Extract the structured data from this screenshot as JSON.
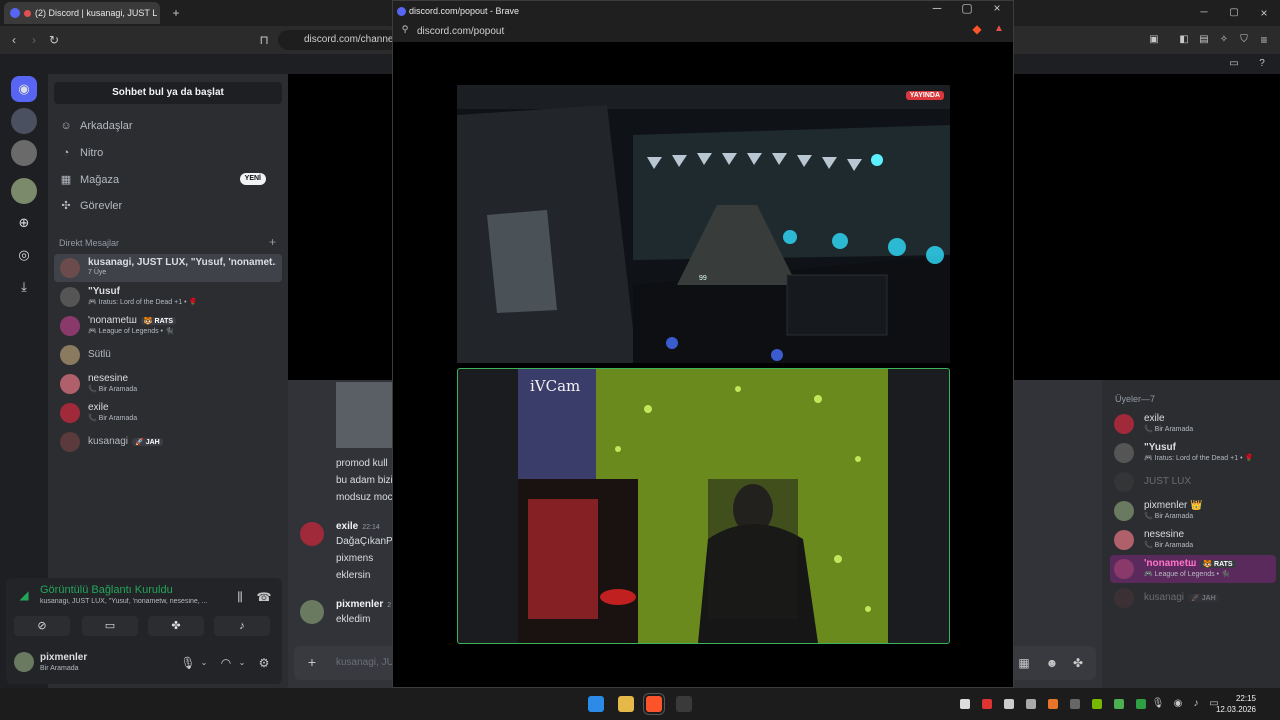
{
  "browser": {
    "tab_title": "(2) Discord | kusanagi, JUST L",
    "address": "discord.com/channel"
  },
  "popup": {
    "title": "discord.com/popout - Brave",
    "url": "discord.com/popout",
    "live_badge": "YAYINDA",
    "cam_label": "iVCam",
    "speed_readout": "99"
  },
  "sidebar": {
    "search": "Sohbet bul ya da başlat",
    "nav": [
      {
        "label": "Arkadaşlar",
        "icon": "friends-icon"
      },
      {
        "label": "Nitro",
        "icon": "nitro-icon"
      },
      {
        "label": "Mağaza",
        "icon": "shop-icon",
        "badge": "YENİ"
      },
      {
        "label": "Görevler",
        "icon": "quests-icon"
      }
    ],
    "dm_header": "Direkt Mesajlar",
    "dms": [
      {
        "name": "kusanagi, JUST LUX, \"Yusuf, 'nonamet...",
        "sub": "7 Üye",
        "color": "#6b4b4b"
      },
      {
        "name": "\"Yusuf",
        "sub": "🎮 Iratus: Lord of the Dead +1 • 🌹",
        "color": "#555"
      },
      {
        "name": "'nonametш",
        "tag": "🐯 RATS",
        "sub": "🎮 League of Legends • 🐈‍⬛",
        "color": "#8a3a6a"
      },
      {
        "name": "Sütlü",
        "sub": "",
        "color": "#8a7a60"
      },
      {
        "name": "nesesine",
        "sub": "📞 Bir Aramada",
        "color": "#b0606a"
      },
      {
        "name": "exile",
        "sub": "📞 Bir Aramada",
        "color": "#a02a3a"
      },
      {
        "name": "kusanagi",
        "tag": "🚀 JAH",
        "sub": "",
        "color": "#5a3a3a"
      }
    ],
    "voice": {
      "title": "Görüntülü Bağlantı Kuruldu",
      "sub": "kusanagi, JUST LUX, \"Yusuf, 'nonametw, nesesine, ..."
    },
    "user": {
      "name": "pixmenler",
      "status": "Bir Aramada"
    }
  },
  "chat": {
    "partial_lines": [
      "promod kull",
      "bu adam bizi",
      "modsuz moc"
    ],
    "messages": [
      {
        "author": "exile",
        "time": "22:14",
        "lines": [
          "DağaÇıkanP",
          "pixmens",
          "eklersin"
        ]
      },
      {
        "author": "pixmenler",
        "time": "2",
        "lines": [
          "ekledim"
        ]
      }
    ],
    "input_placeholder": "kusanagi, JU"
  },
  "members": {
    "header": "Üyeler—7",
    "list": [
      {
        "name": "exile",
        "sub": "📞 Bir Aramada",
        "color": "#a02a3a"
      },
      {
        "name": "\"Yusuf",
        "sub": "🎮 Iratus: Lord of the Dead +1 • 🌹",
        "color": "#555"
      },
      {
        "name": "JUST LUX",
        "sub": "",
        "color": "#444",
        "dim": true
      },
      {
        "name": "pixmenler 👑",
        "sub": "📞 Bir Aramada",
        "color": "#6a7a60"
      },
      {
        "name": "nesesine",
        "sub": "📞 Bir Aramada",
        "color": "#b0606a"
      },
      {
        "name": "'nonametш",
        "tag": "🐯 RATS",
        "sub": "🎮 League of Legends • 🐈‍⬛",
        "color": "#8a3a6a",
        "highlight": true
      },
      {
        "name": "kusanagi",
        "tag": "🚀 JAH",
        "sub": "",
        "color": "#5a3a3a",
        "dim": true
      }
    ]
  },
  "taskbar": {
    "time": "22:15",
    "date": "12.03.2026"
  }
}
